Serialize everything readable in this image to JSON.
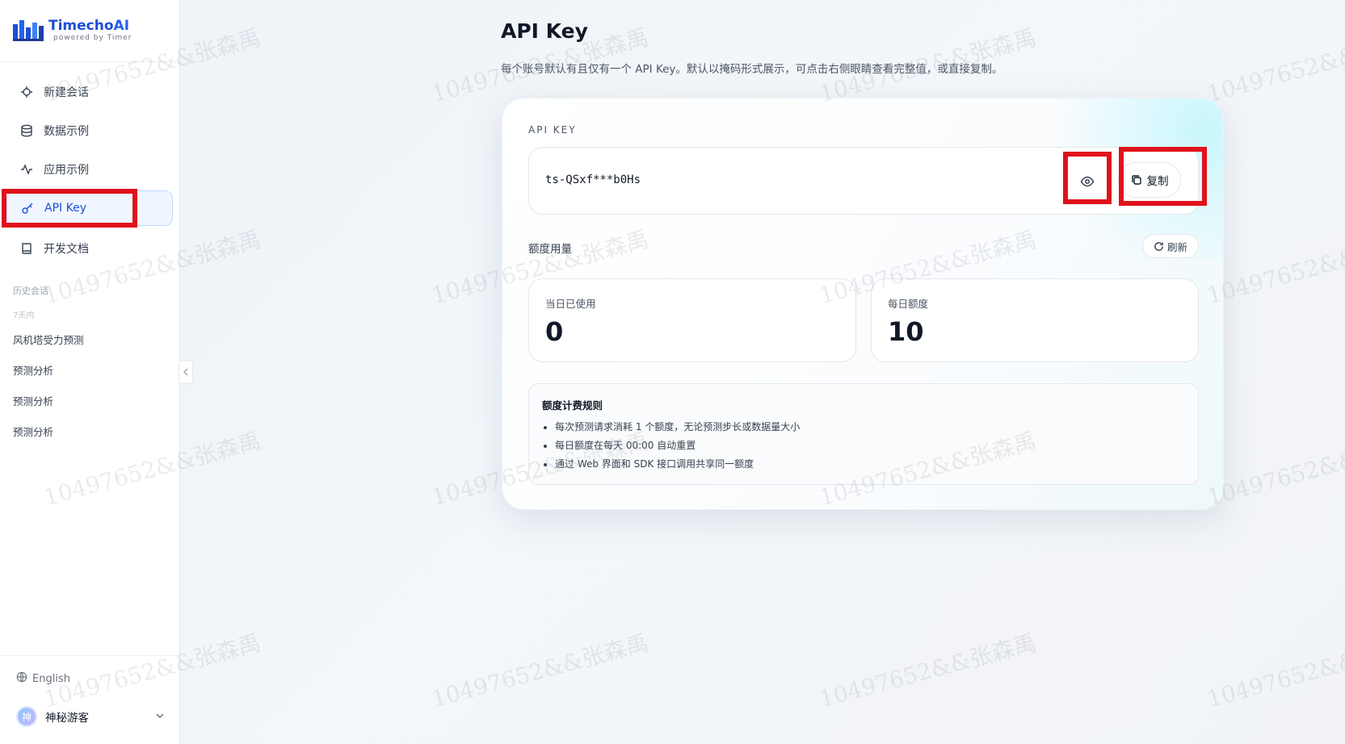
{
  "app": {
    "brand_name_a": "Timecho",
    "brand_name_b": "AI",
    "brand_tagline": "powered by Timer",
    "brand_color": "#1d4ed8"
  },
  "sidebar": {
    "items": [
      {
        "label": "新建会话",
        "icon": "compass-icon"
      },
      {
        "label": "数据示例",
        "icon": "database-icon"
      },
      {
        "label": "应用示例",
        "icon": "activity-icon"
      },
      {
        "label": "API Key",
        "icon": "key-icon",
        "active": true
      },
      {
        "label": "开发文档",
        "icon": "book-icon"
      }
    ],
    "history_label": "历史会话",
    "history_group": "7天内",
    "history": [
      "风机塔受力预测",
      "预测分析",
      "预测分析",
      "预测分析"
    ],
    "language": "English",
    "user_name": "神秘游客",
    "user_avatar": "神"
  },
  "main": {
    "title": "API Key",
    "subtitle": "每个账号默认有且仅有一个 API Key。默认以掩码形式展示，可点击右侧眼睛查看完整值，或直接复制。",
    "key_label": "API KEY",
    "key_value": "ts-QSxf***b0Hs",
    "copy_label": "复制",
    "usage_label": "额度用量",
    "refresh_label": "刷新",
    "used_today_label": "当日已使用",
    "used_today_value": "0",
    "daily_quota_label": "每日额度",
    "daily_quota_value": "10",
    "rules_title": "额度计费规则",
    "rules": [
      "每次预测请求消耗 1 个额度，无论预测步长或数据量大小",
      "每日额度在每天 00:00 自动重置",
      "通过 Web 界面和 SDK 接口调用共享同一额度"
    ]
  },
  "watermark_text": "10497652&&张森禹",
  "highlight_color": "#e0121b"
}
